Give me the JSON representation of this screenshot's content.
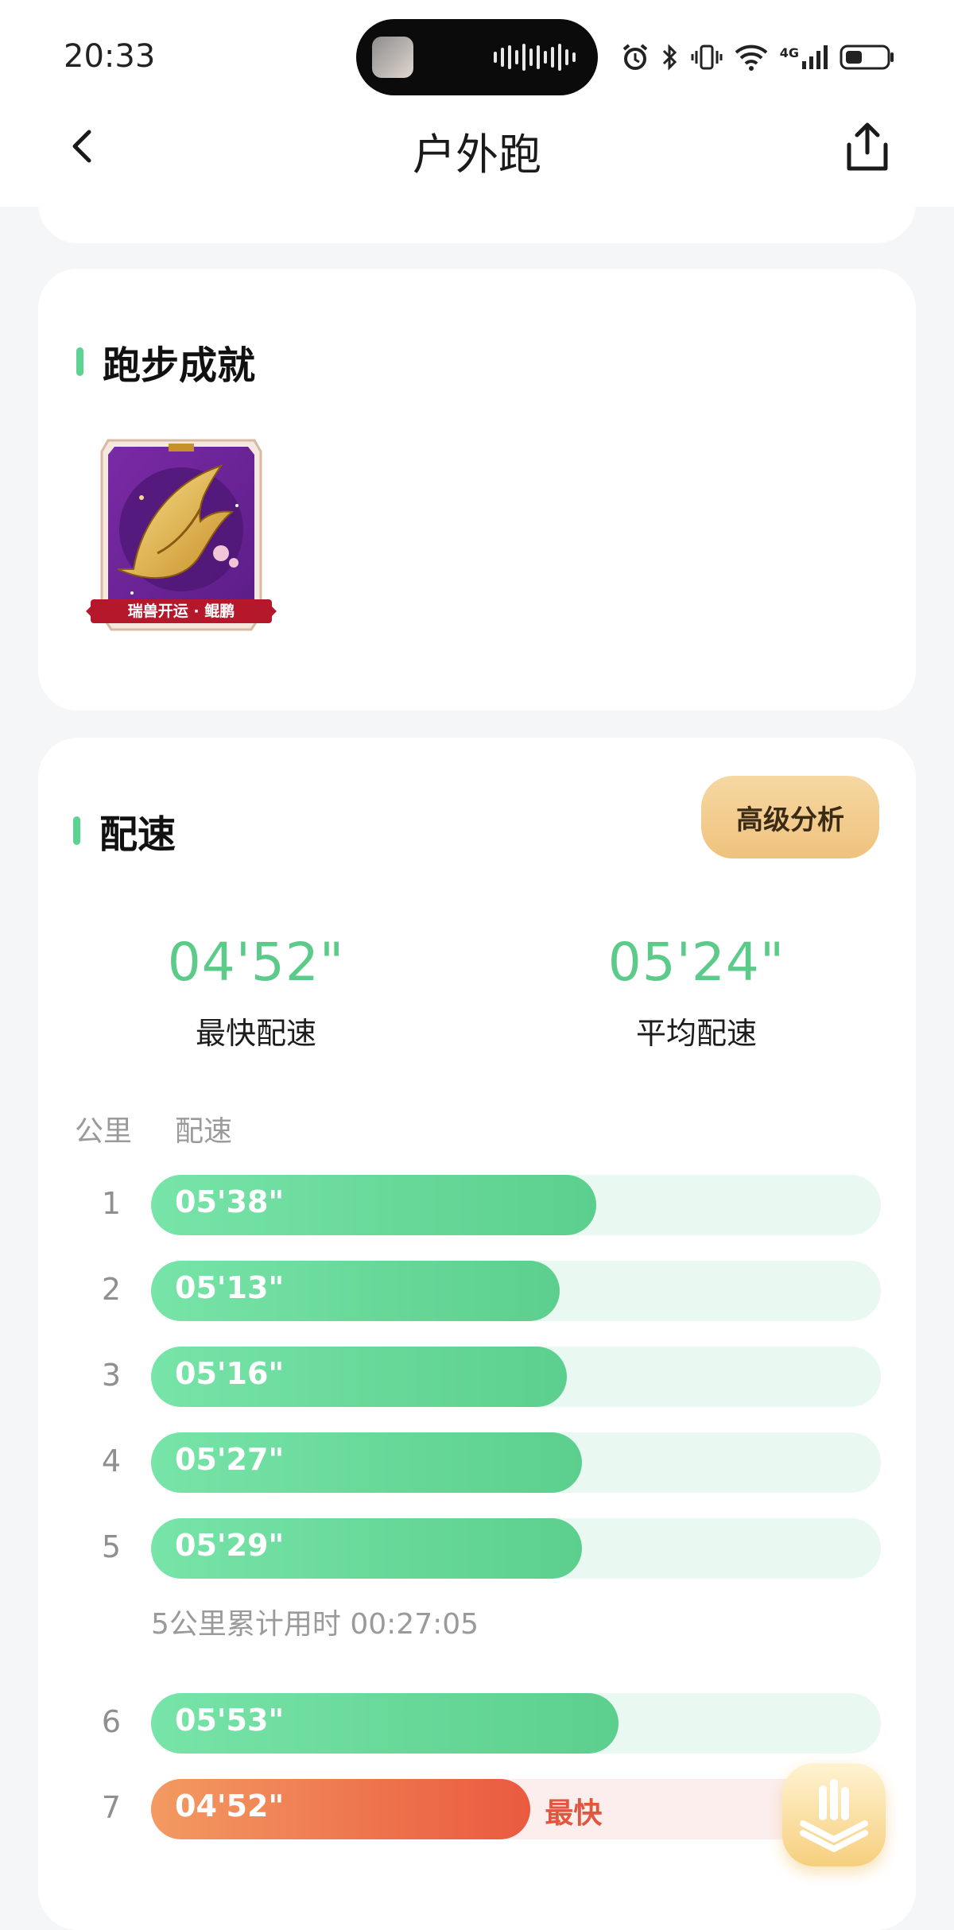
{
  "status_bar": {
    "time": "20:33",
    "network": "4G"
  },
  "header": {
    "title": "户外跑"
  },
  "achievements": {
    "title": "跑步成就",
    "badge_text": "瑞兽开运 · 鲲鹏"
  },
  "pace": {
    "title": "配速",
    "advanced_button": "高级分析",
    "fastest": {
      "value": "04'52\"",
      "label": "最快配速"
    },
    "average": {
      "value": "05'24\"",
      "label": "平均配速"
    },
    "col_km": "公里",
    "col_pace": "配速",
    "splits": [
      {
        "km": "1",
        "pace": "05'38\"",
        "fill": 0.61
      },
      {
        "km": "2",
        "pace": "05'13\"",
        "fill": 0.56
      },
      {
        "km": "3",
        "pace": "05'16\"",
        "fill": 0.57
      },
      {
        "km": "4",
        "pace": "05'27\"",
        "fill": 0.59
      },
      {
        "km": "5",
        "pace": "05'29\"",
        "fill": 0.59
      },
      {
        "km": "6",
        "pace": "05'53\"",
        "fill": 0.64
      },
      {
        "km": "7",
        "pace": "04'52\"",
        "fill": 0.52,
        "tag": "最快"
      }
    ],
    "cumulative_text": "5公里累计用时 00:27:05"
  },
  "colors": {
    "accent_green": "#5ccf8e",
    "fast_red": "#ea5a3f",
    "gold": "#efc27d"
  }
}
